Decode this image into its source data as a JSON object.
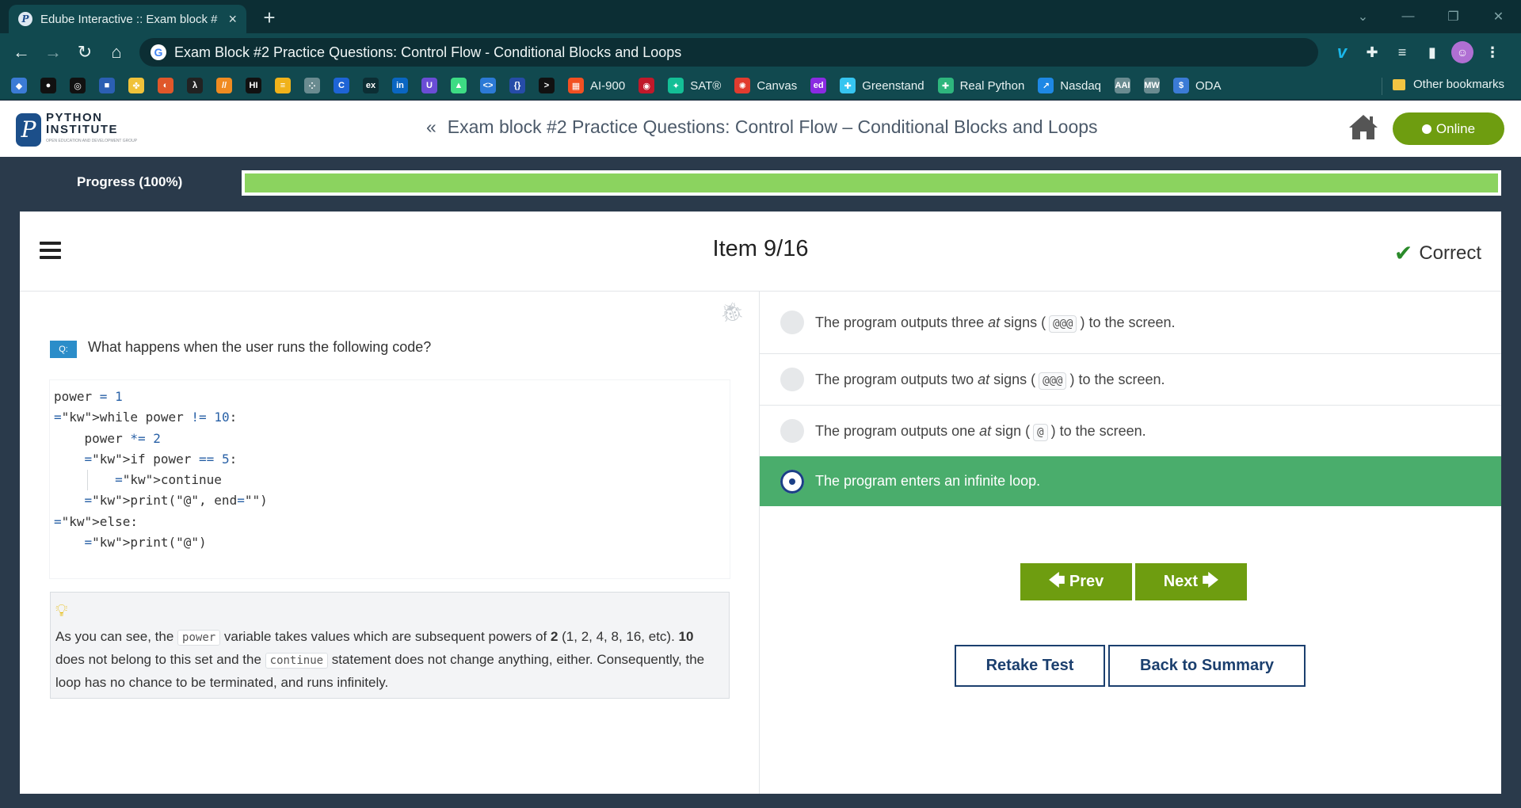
{
  "browser": {
    "tab_title": "Edube Interactive :: Exam block #",
    "tab_close": "×",
    "new_tab": "+",
    "url_text": "Exam Block #2 Practice Questions: Control Flow - Conditional Blocks and Loops",
    "bookmarks": [
      {
        "label": "",
        "icon": "graduation-icon",
        "color": "#3b7bd6"
      },
      {
        "label": "",
        "icon": "github-icon",
        "color": "#111111"
      },
      {
        "label": "",
        "icon": "circle-icon",
        "color": "#111111"
      },
      {
        "label": "",
        "icon": "square-icon",
        "color": "#2b5fb3"
      },
      {
        "label": "",
        "icon": "python-icon",
        "color": "#f0c23a"
      },
      {
        "label": "",
        "icon": "swirl-icon",
        "color": "#e0572a"
      },
      {
        "label": "",
        "icon": "lambda-icon",
        "color": "#222222"
      },
      {
        "label": "",
        "icon": "slash-icon",
        "color": "#f08b21"
      },
      {
        "label": "",
        "icon": "hi-icon",
        "color": "#111111"
      },
      {
        "label": "",
        "icon": "stack-icon",
        "color": "#f0b21a"
      },
      {
        "label": "",
        "icon": "dots-icon",
        "color": "#6a8b90"
      },
      {
        "label": "",
        "icon": "c-icon",
        "color": "#1e64d6"
      },
      {
        "label": "",
        "icon": "edx-icon",
        "color": "#0c2e34"
      },
      {
        "label": "",
        "icon": "linkedin-icon",
        "color": "#0a66c2"
      },
      {
        "label": "",
        "icon": "u-icon",
        "color": "#6a4dd6"
      },
      {
        "label": "",
        "icon": "android-icon",
        "color": "#3ddc84"
      },
      {
        "label": "",
        "icon": "code-icon",
        "color": "#2c7ad6"
      },
      {
        "label": "",
        "icon": "brackets-icon",
        "color": "#264ca8"
      },
      {
        "label": "",
        "icon": "terminal-icon",
        "color": "#111111"
      },
      {
        "label": "AI-900",
        "icon": "microsoft-icon",
        "color": "#f25022"
      },
      {
        "label": "",
        "icon": "apple-icon",
        "color": "#c0192a"
      },
      {
        "label": "SAT®",
        "icon": "khan-icon",
        "color": "#14bf96"
      },
      {
        "label": "Canvas",
        "icon": "canvas-icon",
        "color": "#e13c2f"
      },
      {
        "label": "",
        "icon": "ed-icon",
        "color": "#8a2be2"
      },
      {
        "label": "Greenstand",
        "icon": "slack-icon",
        "color": "#36c5f0"
      },
      {
        "label": "Real Python",
        "icon": "slack-icon",
        "color": "#2eb67d"
      },
      {
        "label": "Nasdaq",
        "icon": "chart-icon",
        "color": "#1e88e5"
      },
      {
        "label": "",
        "icon": "aai-icon",
        "color": "#6a8b90"
      },
      {
        "label": "",
        "icon": "mw-icon",
        "color": "#6a8b90"
      },
      {
        "label": "ODA",
        "icon": "dollar-icon",
        "color": "#3b7bd6"
      }
    ],
    "other_bookmarks": "Other bookmarks"
  },
  "header": {
    "logo_line1": "PYTHON",
    "logo_line2": "INSTITUTE",
    "logo_tagline": "OPEN EDUCATION AND DEVELOPMENT GROUP",
    "back_chevron": "«",
    "exam_title": "Exam block #2 Practice Questions: Control Flow – Conditional Blocks and Loops",
    "online_label": "Online"
  },
  "progress": {
    "label": "Progress (100%)",
    "percent": 100,
    "fill_color": "#8bd35f"
  },
  "item": {
    "counter": "Item 9/16",
    "status": "Correct",
    "q_badge": "Q:",
    "question": "What happens when the user runs the following code?",
    "code_lines": [
      "power = 1",
      "while power != 10:",
      "    power *= 2",
      "    if power == 5:",
      "        continue",
      "    print(\"@\", end=\"\")",
      "else:",
      "    print(\"@\")"
    ],
    "hint": {
      "t1": "As you can see, the ",
      "code1": "power",
      "t2": " variable takes values which are subsequent powers of ",
      "b1": "2",
      "t3": " (1, 2, 4, 8, 16, etc). ",
      "b2": "10",
      "t4": " does not belong to this set and the ",
      "code2": "continue",
      "t5": " statement does not change anything, either. Consequently, the loop has no chance to be terminated, and runs infinitely."
    },
    "options": [
      {
        "pre": "The program outputs three ",
        "em": "at",
        "mid": " signs (",
        "code": "@@@",
        "post": ") to the screen.",
        "selected": false
      },
      {
        "pre": "The program outputs two ",
        "em": "at",
        "mid": " signs (",
        "code": "@@@",
        "post": ") to the screen.",
        "selected": false
      },
      {
        "pre": "The program outputs one ",
        "em": "at",
        "mid": " sign (",
        "code": "@",
        "post": ") to the screen.",
        "selected": false
      },
      {
        "pre": "The program enters an infinite loop.",
        "em": "",
        "mid": "",
        "code": "",
        "post": "",
        "selected": true
      }
    ],
    "prev_label": "Prev",
    "next_label": "Next",
    "retake_label": "Retake Test",
    "summary_label": "Back to Summary"
  },
  "colors": {
    "accent_green": "#6e9d10",
    "correct_bg": "#4aad6c",
    "navy": "#1b3f6e"
  }
}
